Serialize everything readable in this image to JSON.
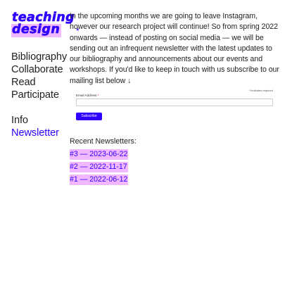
{
  "logo": {
    "line1": "teaching",
    "line2": "design",
    "mark": "*"
  },
  "nav": {
    "items": [
      {
        "label": "Bibliography"
      },
      {
        "label": "Collaborate"
      },
      {
        "label": "Read"
      },
      {
        "label": "Participate"
      }
    ],
    "secondary": [
      {
        "label": "Info"
      },
      {
        "label": "Newsletter"
      }
    ]
  },
  "intro": {
    "text": "In the upcoming months we are going to leave Instagram, however our research project will continue! So from spring 2022 onwards — instead of posting on social media — we will be sending out an infrequent newsletter with the latest updates to our bibliography and announcements about our events and workshops. If you'd like to keep in touch with us subscribe to our mailing list below ↓"
  },
  "form": {
    "required_note": "indicates required",
    "required_mark": "*",
    "email_label": "Email Address",
    "email_value": "",
    "subscribe_label": "Subscribe"
  },
  "recent": {
    "title": "Recent Newsletters:",
    "items": [
      {
        "label": "#3 — 2023-06-22"
      },
      {
        "label": "#2 — 2022-11-17"
      },
      {
        "label": "#1 — 2022-06-12"
      }
    ]
  },
  "colors": {
    "accent": "#2f00ff",
    "highlight": "#f2b8ff",
    "text": "#222222"
  }
}
